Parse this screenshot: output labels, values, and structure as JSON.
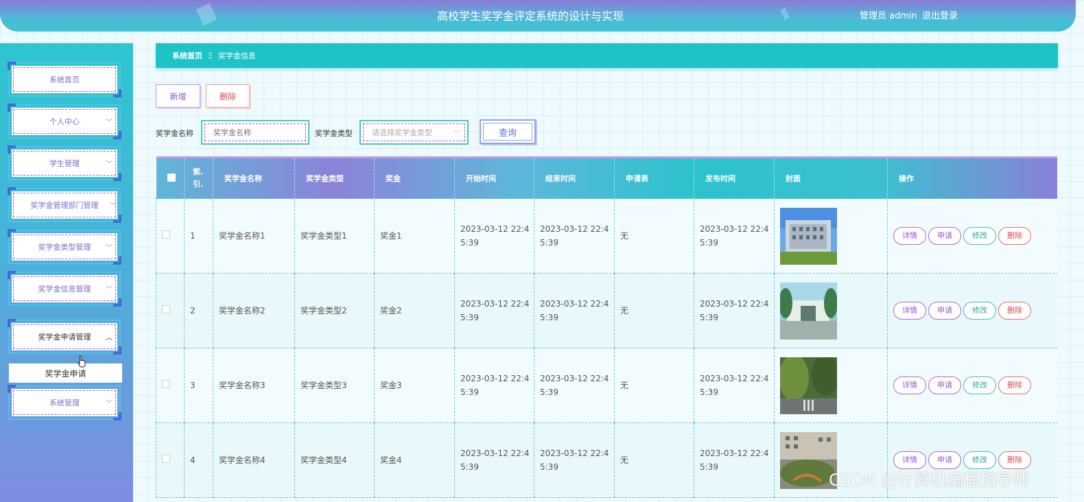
{
  "header": {
    "title": "高校学生奖学金评定系统的设计与实现",
    "user": "管理员 admin",
    "logout": "退出登录"
  },
  "sidebar": {
    "items": [
      {
        "label": "系统首页"
      },
      {
        "label": "个人中心"
      },
      {
        "label": "学生管理"
      },
      {
        "label": "奖学金管理部门管理"
      },
      {
        "label": "奖学金类型管理"
      },
      {
        "label": "奖学金信息管理"
      },
      {
        "label": "奖学金申请管理"
      },
      {
        "label": "系统管理"
      }
    ],
    "submenu_item": "奖学金申请"
  },
  "breadcrumb": {
    "home": "系统首页",
    "separator": "Ξ",
    "current": "奖学金信息"
  },
  "actions": {
    "add": "新增",
    "delete": "删除"
  },
  "search": {
    "name_label": "奖学金名称",
    "name_placeholder": "奖学金名称",
    "type_label": "奖学金类型",
    "type_placeholder": "请选择奖学金类型",
    "query": "查询"
  },
  "table": {
    "columns": [
      "索引",
      "奖学金名称",
      "奖学金类型",
      "奖金",
      "开始时间",
      "结束时间",
      "申请表",
      "发布时间",
      "封面",
      "操作"
    ],
    "index_header_line1": "索.",
    "index_header_line2": "引.",
    "rows": [
      {
        "index": "1",
        "name": "奖学金名称1",
        "type": "奖学金类型1",
        "bonus": "奖金1",
        "start_l1": "2023-03-12 22:4",
        "start_l2": "5:39",
        "end_l1": "2023-03-12 22:4",
        "end_l2": "5:39",
        "form": "无",
        "pub_l1": "2023-03-12 22:4",
        "pub_l2": "5:39"
      },
      {
        "index": "2",
        "name": "奖学金名称2",
        "type": "奖学金类型2",
        "bonus": "奖金2",
        "start_l1": "2023-03-12 22:4",
        "start_l2": "5:39",
        "end_l1": "2023-03-12 22:4",
        "end_l2": "5:39",
        "form": "无",
        "pub_l1": "2023-03-12 22:4",
        "pub_l2": "5:39"
      },
      {
        "index": "3",
        "name": "奖学金名称3",
        "type": "奖学金类型3",
        "bonus": "奖金3",
        "start_l1": "2023-03-12 22:4",
        "start_l2": "5:39",
        "end_l1": "2023-03-12 22:4",
        "end_l2": "5:39",
        "form": "无",
        "pub_l1": "2023-03-12 22:4",
        "pub_l2": "5:39"
      },
      {
        "index": "4",
        "name": "奖学金名称4",
        "type": "奖学金类型4",
        "bonus": "奖金4",
        "start_l1": "2023-03-12 22:4",
        "start_l2": "5:39",
        "end_l1": "2023-03-12 22:4",
        "end_l2": "5:39",
        "form": "无",
        "pub_l1": "2023-03-12 22:4",
        "pub_l2": "5:39"
      }
    ],
    "ops": {
      "detail": "详情",
      "apply": "申请",
      "edit": "修改",
      "delete": "删除"
    }
  },
  "watermark": "CSDN @计算机编程指导师",
  "colors": {
    "accent": "#1ec3c8",
    "purple": "#9a55d0",
    "danger": "#d94c4c"
  }
}
